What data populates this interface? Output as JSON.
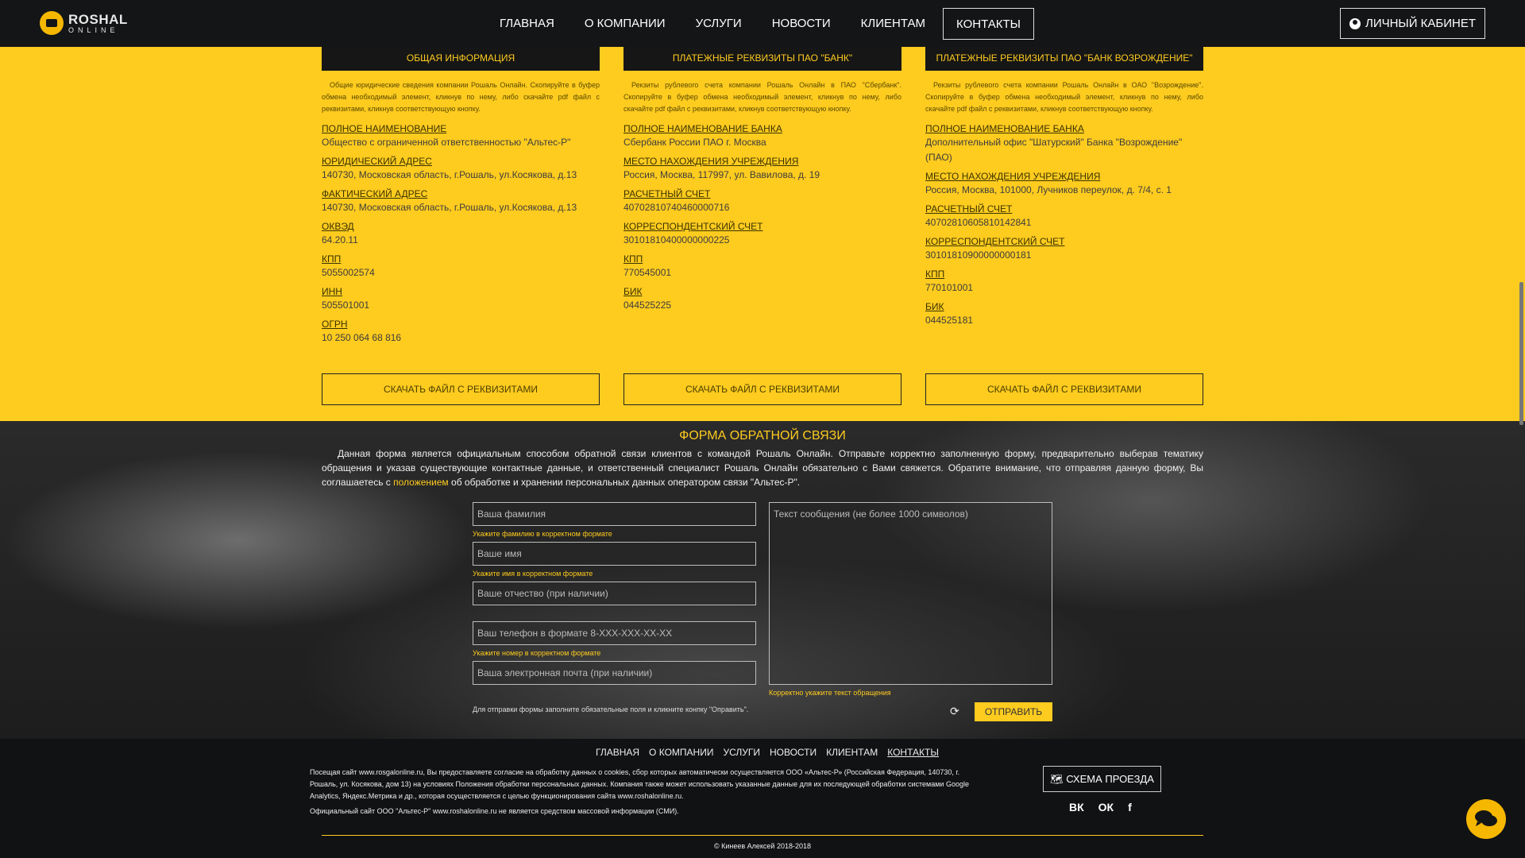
{
  "header": {
    "logo_line1": "ROSHAL",
    "logo_line2": "ONLINE",
    "nav": [
      "ГЛАВНАЯ",
      "О КОМПАНИИ",
      "УСЛУГИ",
      "НОВОСТИ",
      "КЛИЕНТАМ",
      "КОНТАКТЫ"
    ],
    "active_nav": "КОНТАКТЫ",
    "cabinet_label": "ЛИЧНЫЙ КАБИНЕТ"
  },
  "columns": [
    {
      "title": "ОБЩАЯ ИНФОРМАЦИЯ",
      "desc": "Общие юридические сведения компании Рошаль Онлайн. Скопируйте в буфер обмена необходимый элемент, кликнув по нему, либо скачайте pdf файл с реквизитами, кликнув соответствующую кнопку.",
      "fields": [
        {
          "label": "ПОЛНОЕ НАИМЕНОВАНИЕ",
          "value": "Общество с ограниченной ответственностью \"Альтес-Р\""
        },
        {
          "label": "ЮРИДИЧЕСКИЙ АДРЕС",
          "value": "140730, Московская область, г.Рошаль, ул.Косякова, д.13"
        },
        {
          "label": "ФАКТИЧЕСКИЙ АДРЕС",
          "value": "140730, Московская область, г.Рошаль, ул.Косякова, д.13"
        },
        {
          "label": "ОКВЭД",
          "value": "64.20.11"
        },
        {
          "label": "КПП",
          "value": "5055002574"
        },
        {
          "label": "ИНН",
          "value": "505501001"
        },
        {
          "label": "ОГРН",
          "value": "10 250 064 68 816"
        }
      ],
      "button": "СКАЧАТЬ ФАЙЛ С РЕКВИЗИТАМИ"
    },
    {
      "title": "ПЛАТЕЖНЫЕ РЕКВИЗИТЫ ПАО \"БАНК\"",
      "desc": "Рекзиты рублевого счета компании Рошаль Онлайн в ПАО \"Сбербанк\". Скопируйте в буфер обмена необходимый элемент, кликнув по нему, либо скачайте pdf файл с реквизитами, кликнув соответствующую кнопку.",
      "fields": [
        {
          "label": "ПОЛНОЕ НАИМЕНОВАНИЕ БАНКА",
          "value": "Сбербанк России ПАО г. Москва"
        },
        {
          "label": "МЕСТО НАХОЖДЕНИЯ УЧРЕЖДЕНИЯ",
          "value": "Россия, Москва, 117997, ул. Вавилова, д. 19"
        },
        {
          "label": "РАСЧЕТНЫЙ СЧЕТ",
          "value": "40702810740460000716"
        },
        {
          "label": "КОРРЕСПОНДЕНТСКИЙ СЧЕТ",
          "value": "30101810400000000225"
        },
        {
          "label": "КПП",
          "value": "770545001"
        },
        {
          "label": "БИК",
          "value": "044525225"
        }
      ],
      "button": "СКАЧАТЬ ФАЙЛ С РЕКВИЗИТАМИ"
    },
    {
      "title": "ПЛАТЕЖНЫЕ РЕКВИЗИТЫ ПАО \"БАНК ВОЗРОЖДЕНИЕ\"",
      "desc": "Рекзиты рублевого счета компании Рошаль Онлайн в ОАО \"Возрождение\". Скопируйте в буфер обмена необходимый элемент, кликнув по нему, либо скачайте pdf файл с реквизитами, кликнув соответствующую кнопку.",
      "fields": [
        {
          "label": "ПОЛНОЕ НАИМЕНОВАНИЕ БАНКА",
          "value": "Дополнительный офис \"Шатурский\" Банка \"Возрождение\" (ПАО)"
        },
        {
          "label": "МЕСТО НАХОЖДЕНИЯ УЧРЕЖДЕНИЯ",
          "value": "Россия, Москва, 101000, Лучников переулок, д. 7/4, с. 1"
        },
        {
          "label": "РАСЧЕТНЫЙ СЧЕТ",
          "value": "40702810605810142841"
        },
        {
          "label": "КОРРЕСПОНДЕНТСКИЙ СЧЕТ",
          "value": "30101810900000000181"
        },
        {
          "label": "КПП",
          "value": "770101001"
        },
        {
          "label": "БИК",
          "value": "044525181"
        }
      ],
      "button": "СКАЧАТЬ ФАЙЛ С РЕКВИЗИТАМИ"
    }
  ],
  "form": {
    "title": "ФОРМА ОБРАТНОЙ СВЯЗИ",
    "text_before": "Данная форма является официальным способом обратной связи клиентов с командой Рошаль Онлайн. Отправьте корректно заполненную форму, предварительно выберав тематику обращения и указав существующие контактные данные, и ответственный специалист Рошаль Онлайн обязательно с Вами свяжется. Обратите внимание, что отправляя данную форму, Вы соглашаетесь с ",
    "text_link": "положением",
    "text_after": " об обработке и хранении персональных данных оператором связи \"Альтес-Р\".",
    "surname_placeholder": "Ваша фамилия",
    "surname_error": "Укажите фамилию в корректном формате",
    "name_placeholder": "Ваше имя",
    "name_error": "Укажите имя в корректном формате",
    "patronymic_placeholder": "Ваше отчество (при наличии)",
    "phone_placeholder": "Ваш телефон в формате 8-XXX-XXX-XX-XX",
    "phone_error": "Укажите номер в корректном формате",
    "email_placeholder": "Ваша электронная почта (при наличии)",
    "message_placeholder": "Текст сообщения (не более 1000 символов)",
    "message_error": "Корректно укажите текст обращения",
    "note": "Для отправки формы заполните обязательные поля и кликните конпку \"Оправить\".",
    "submit": "ОТПРАВИТЬ"
  },
  "footer": {
    "nav": [
      "ГЛАВНАЯ",
      "О КОМПАНИИ",
      "УСЛУГИ",
      "НОВОСТИ",
      "КЛИЕНТАМ",
      "КОНТАКТЫ"
    ],
    "text1": "Посещая сайт www.rosgalonline.ru, Вы предоставляете согласие на обработку данных о cookies, сбор которых автоматически осуществляется ООО «Альтес-Р» (Российская Федерация, 140730, г. Рошаль, ул. Косякова, дом 13) на условиях Положения обработки персональных данных. Компания также может использовать указанные данные для их последующей обработки системами Google Analytics, Яндекс.Метрика и др., которая осуществляется с целью функционирования сайта www.roshalonline.ru.",
    "text2": "Официальный сайт ООО \"Альтес-Р\" www.roshalonline.ru не является средством массовой информации (СМИ).",
    "route_button": "СХЕМА ПРОЕЗДА",
    "social": [
      "ВК",
      "ОК",
      "f"
    ],
    "copyright": "© Кинеев Алексей 2018-2018"
  },
  "colors": {
    "accent": "#fecb1f",
    "dark": "#141517"
  }
}
